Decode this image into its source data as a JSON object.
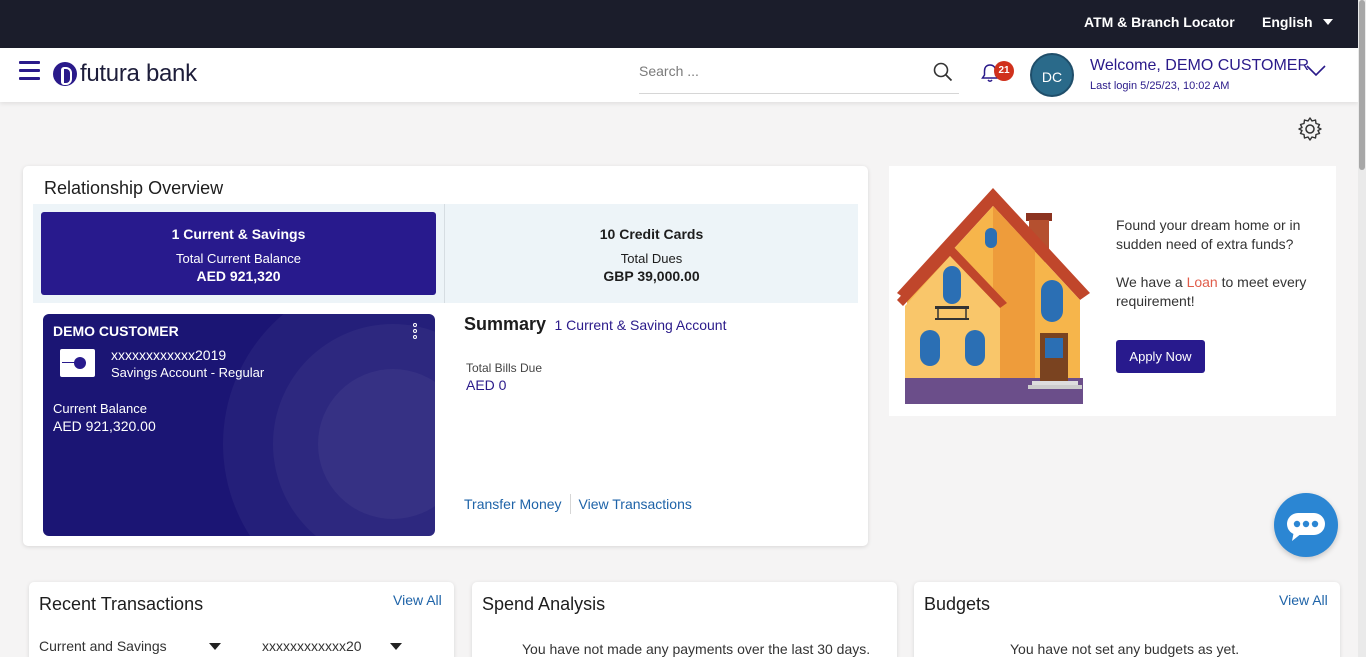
{
  "topbar": {
    "atm_locator": "ATM & Branch Locator",
    "language": "English"
  },
  "header": {
    "logo_text": "futura bank",
    "search_placeholder": "Search ...",
    "notification_count": "21",
    "avatar_initials": "DC",
    "welcome": "Welcome, DEMO CUSTOMER",
    "last_login": "Last login 5/25/23, 10:02 AM"
  },
  "overview": {
    "title": "Relationship Overview",
    "tabs": [
      {
        "title": "1 Current & Savings",
        "sub_label": "Total Current Balance",
        "value": "AED 921,320"
      },
      {
        "title": "10 Credit Cards",
        "sub_label": "Total Dues",
        "value": "GBP 39,000.00"
      }
    ],
    "card": {
      "customer_name": "DEMO CUSTOMER",
      "account_number": "xxxxxxxxxxxx2019",
      "account_type": "Savings Account - Regular",
      "balance_label": "Current Balance",
      "balance_value": "AED 921,320.00"
    },
    "summary": {
      "title": "Summary",
      "subtitle": "1 Current & Saving Account",
      "bills_label": "Total Bills Due",
      "bills_value": "AED 0",
      "link_transfer": "Transfer Money",
      "link_transactions": "View Transactions"
    }
  },
  "promo": {
    "line1": "Found your dream home or in sudden need of extra funds?",
    "line2_pre": "We have a ",
    "line2_loan": "Loan",
    "line2_post": " to meet every requirement!",
    "button": "Apply Now"
  },
  "recent_transactions": {
    "title": "Recent Transactions",
    "view_all": "View All",
    "filter_type": "Current and Savings",
    "filter_account": "xxxxxxxxxxxx20"
  },
  "spend_analysis": {
    "title": "Spend Analysis",
    "empty_message": "You have not made any payments over the last 30 days."
  },
  "budgets": {
    "title": "Budgets",
    "view_all": "View All",
    "empty_message": "You have not set any budgets as yet."
  },
  "colors": {
    "brand_primary": "#281a8d",
    "topbar": "#1b1d2b",
    "link": "#1e63a8",
    "badge": "#d0311c",
    "chat": "#2b86d3"
  }
}
